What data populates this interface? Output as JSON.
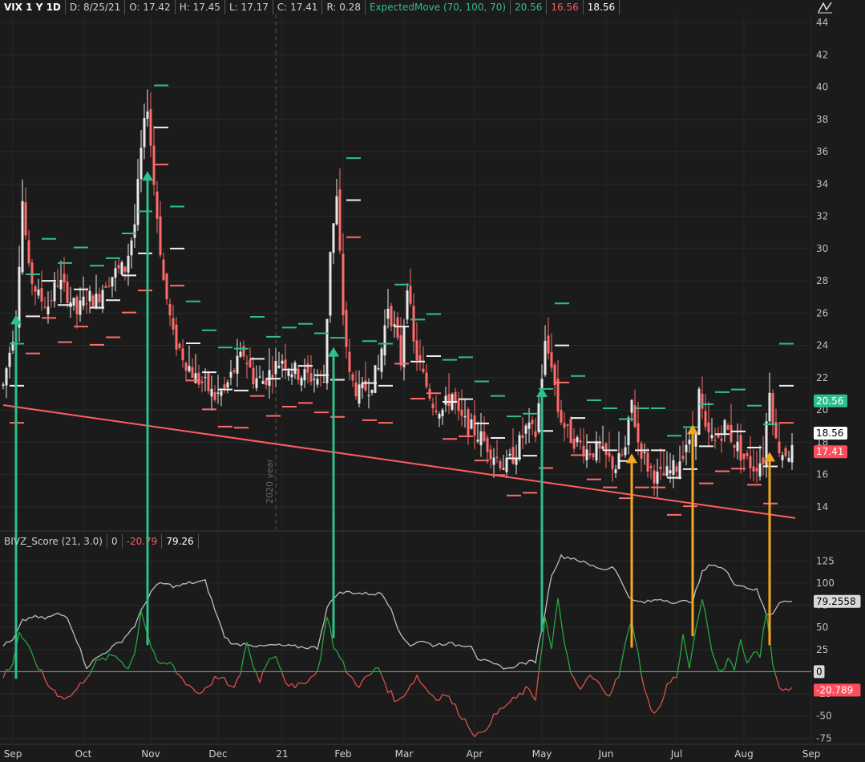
{
  "header": {
    "symbol": "VIX 1 Y 1D",
    "date": "D: 8/25/21",
    "open": "O: 17.42",
    "high": "H: 17.45",
    "low": "L: 17.17",
    "close": "C: 17.41",
    "range": "R: 0.28",
    "study": "ExpectedMove (70, 100, 70)",
    "upper": "20.56",
    "lower": "16.56",
    "mid": "18.56"
  },
  "subpanel": {
    "study": "BIVZ_Score (21, 3.0)",
    "zero": "0",
    "value1": "-20.79",
    "value2": "79.26"
  },
  "tool_icon": "drawing-tool-icon",
  "colors": {
    "background": "#1b1b1b",
    "up": "#e8e8e8",
    "down": "#ff6b6b",
    "teal": "#2fbf8a",
    "orange": "#f5a623",
    "trend": "#ff5f5f",
    "gray_line": "#bdbdbd",
    "green_line": "#26a641",
    "red_line": "#e0504a"
  },
  "chart_data": [
    {
      "type": "candlestick",
      "title": "VIX 1 Y 1D",
      "ylim": [
        12.6,
        44.5
      ],
      "yticks": [
        14,
        16,
        18,
        20,
        22,
        24,
        26,
        28,
        30,
        32,
        34,
        36,
        38,
        40,
        42,
        44
      ],
      "xticks": [
        {
          "label": "Sep",
          "x": 3
        },
        {
          "label": "Oct",
          "x": 25
        },
        {
          "label": "Nov",
          "x": 46
        },
        {
          "label": "Dec",
          "x": 67
        },
        {
          "label": "21",
          "x": 87
        },
        {
          "label": "Feb",
          "x": 106
        },
        {
          "label": "Mar",
          "x": 125
        },
        {
          "label": "Apr",
          "x": 147
        },
        {
          "label": "May",
          "x": 168
        },
        {
          "label": "Jun",
          "x": 188
        },
        {
          "label": "Jul",
          "x": 210
        },
        {
          "label": "Aug",
          "x": 231
        },
        {
          "label": "Sep",
          "x": 252
        }
      ],
      "year_marker": {
        "label": "2020 year",
        "x": 85
      },
      "price_labels": [
        {
          "value": 20.56,
          "text": "20.56",
          "style": "teal"
        },
        {
          "value": 18.56,
          "text": "18.56",
          "style": "white"
        },
        {
          "value": 17.41,
          "text": "17.41",
          "style": "red"
        }
      ],
      "trend_line": [
        [
          0,
          20.3
        ],
        [
          247,
          13.3
        ]
      ],
      "keypoints": [
        [
          0,
          21.5
        ],
        [
          4,
          25.8
        ],
        [
          6,
          33.0
        ],
        [
          8,
          28.5
        ],
        [
          11,
          27.0
        ],
        [
          14,
          26.5
        ],
        [
          17,
          28.0
        ],
        [
          20,
          27.2
        ],
        [
          23,
          26.0
        ],
        [
          26,
          27.0
        ],
        [
          29,
          26.8
        ],
        [
          32,
          28.0
        ],
        [
          35,
          28.5
        ],
        [
          38,
          28.8
        ],
        [
          41,
          31.5
        ],
        [
          43,
          36.0
        ],
        [
          45,
          39.0
        ],
        [
          47,
          34.0
        ],
        [
          50,
          28.0
        ],
        [
          53,
          24.5
        ],
        [
          57,
          23.0
        ],
        [
          60,
          22.0
        ],
        [
          63,
          21.5
        ],
        [
          66,
          20.8
        ],
        [
          69,
          21.2
        ],
        [
          72,
          22.5
        ],
        [
          75,
          23.5
        ],
        [
          78,
          22.0
        ],
        [
          81,
          21.8
        ],
        [
          84,
          22.5
        ],
        [
          87,
          23.2
        ],
        [
          90,
          22.5
        ],
        [
          93,
          22.2
        ],
        [
          97,
          22.0
        ],
        [
          100,
          21.8
        ],
        [
          102,
          30.0
        ],
        [
          104,
          33.0
        ],
        [
          106,
          26.0
        ],
        [
          108,
          22.0
        ],
        [
          111,
          21.0
        ],
        [
          114,
          21.5
        ],
        [
          117,
          22.5
        ],
        [
          120,
          26.5
        ],
        [
          122,
          25.0
        ],
        [
          124,
          23.0
        ],
        [
          126,
          28.0
        ],
        [
          128,
          24.0
        ],
        [
          131,
          22.0
        ],
        [
          134,
          20.5
        ],
        [
          137,
          20.0
        ],
        [
          140,
          21.0
        ],
        [
          142,
          19.5
        ],
        [
          145,
          19.0
        ],
        [
          148,
          18.5
        ],
        [
          151,
          17.8
        ],
        [
          154,
          17.0
        ],
        [
          157,
          16.5
        ],
        [
          160,
          17.5
        ],
        [
          163,
          18.8
        ],
        [
          166,
          18.5
        ],
        [
          169,
          24.0
        ],
        [
          171,
          23.0
        ],
        [
          173,
          20.0
        ],
        [
          176,
          18.5
        ],
        [
          179,
          18.0
        ],
        [
          182,
          17.5
        ],
        [
          185,
          17.5
        ],
        [
          188,
          17.0
        ],
        [
          191,
          16.5
        ],
        [
          194,
          17.5
        ],
        [
          196,
          20.5
        ],
        [
          198,
          18.0
        ],
        [
          201,
          16.5
        ],
        [
          204,
          15.8
        ],
        [
          207,
          16.0
        ],
        [
          210,
          16.5
        ],
        [
          213,
          18.0
        ],
        [
          215,
          17.5
        ],
        [
          217,
          21.0
        ],
        [
          219,
          18.5
        ],
        [
          222,
          18.0
        ],
        [
          225,
          19.0
        ],
        [
          228,
          18.0
        ],
        [
          231,
          17.0
        ],
        [
          234,
          16.5
        ],
        [
          237,
          17.0
        ],
        [
          239,
          21.5
        ],
        [
          241,
          18.0
        ],
        [
          243,
          17.4
        ]
      ],
      "arrows_teal": [
        {
          "x": 4,
          "y_from": -8,
          "y_to": 25.8
        },
        {
          "x": 45,
          "y_from": 30,
          "y_to": 34.7
        },
        {
          "x": 103,
          "y_from": 38,
          "y_to": 23.8
        },
        {
          "x": 168,
          "y_from": 45,
          "y_to": 21.3
        }
      ],
      "arrows_orange": [
        {
          "x": 196,
          "y_from": 27,
          "y_to": 17.2
        },
        {
          "x": 215,
          "y_from": 40,
          "y_to": 19.0
        },
        {
          "x": 239,
          "y_from": 30,
          "y_to": 17.3
        }
      ]
    },
    {
      "type": "line",
      "title": "BIVZ_Score (21, 3.0)",
      "ylim": [
        -82,
        137
      ],
      "yticks": [
        -75,
        -50,
        -25,
        0,
        25,
        50,
        75,
        100,
        125
      ],
      "value_labels": [
        {
          "value": 79.2558,
          "text": "79.2558",
          "style": "gray"
        },
        {
          "value": 0,
          "text": "0",
          "style": "gray"
        },
        {
          "value": -20.789,
          "text": "-20.789",
          "style": "red"
        }
      ],
      "series": [
        {
          "name": "",
          "keypoints": [
            [
              0,
              30
            ],
            [
              3,
              35
            ],
            [
              6,
              57
            ],
            [
              9,
              62
            ],
            [
              13,
              60
            ],
            [
              17,
              65
            ],
            [
              20,
              62
            ],
            [
              23,
              35
            ],
            [
              26,
              5
            ],
            [
              29,
              15
            ],
            [
              33,
              25
            ],
            [
              37,
              35
            ],
            [
              41,
              52
            ],
            [
              43,
              68
            ],
            [
              46,
              90
            ],
            [
              49,
              100
            ],
            [
              54,
              96
            ],
            [
              58,
              100
            ],
            [
              63,
              102
            ],
            [
              66,
              70
            ],
            [
              69,
              40
            ],
            [
              72,
              30
            ],
            [
              76,
              32
            ],
            [
              80,
              28
            ],
            [
              84,
              30
            ],
            [
              88,
              29
            ],
            [
              92,
              28
            ],
            [
              98,
              27
            ],
            [
              101,
              72
            ],
            [
              104,
              88
            ],
            [
              108,
              90
            ],
            [
              112,
              88
            ],
            [
              118,
              88
            ],
            [
              121,
              72
            ],
            [
              124,
              40
            ],
            [
              127,
              30
            ],
            [
              130,
              35
            ],
            [
              134,
              30
            ],
            [
              138,
              32
            ],
            [
              142,
              30
            ],
            [
              146,
              30
            ],
            [
              148,
              15
            ],
            [
              153,
              8
            ],
            [
              158,
              3
            ],
            [
              160,
              8
            ],
            [
              163,
              10
            ],
            [
              166,
              12
            ],
            [
              169,
              68
            ],
            [
              171,
              110
            ],
            [
              174,
              130
            ],
            [
              178,
              128
            ],
            [
              183,
              120
            ],
            [
              188,
              115
            ],
            [
              190,
              120
            ],
            [
              193,
              100
            ],
            [
              196,
              80
            ],
            [
              200,
              78
            ],
            [
              205,
              82
            ],
            [
              210,
              78
            ],
            [
              215,
              80
            ],
            [
              218,
              112
            ],
            [
              221,
              122
            ],
            [
              225,
              115
            ],
            [
              228,
              100
            ],
            [
              232,
              95
            ],
            [
              235,
              92
            ],
            [
              238,
              65
            ],
            [
              240,
              66
            ],
            [
              242,
              79
            ]
          ]
        },
        {
          "name": "",
          "keypoints": [
            [
              0,
              -5
            ],
            [
              3,
              10
            ],
            [
              5,
              45
            ],
            [
              8,
              25
            ],
            [
              11,
              5
            ],
            [
              14,
              -15
            ],
            [
              17,
              -25
            ],
            [
              20,
              -30
            ],
            [
              23,
              -20
            ],
            [
              26,
              -5
            ],
            [
              29,
              10
            ],
            [
              32,
              15
            ],
            [
              35,
              18
            ],
            [
              39,
              5
            ],
            [
              41,
              20
            ],
            [
              43,
              70
            ],
            [
              46,
              30
            ],
            [
              49,
              5
            ],
            [
              52,
              10
            ],
            [
              55,
              -5
            ],
            [
              58,
              -15
            ],
            [
              61,
              -25
            ],
            [
              64,
              -15
            ],
            [
              67,
              -5
            ],
            [
              69,
              -10
            ],
            [
              71,
              -20
            ],
            [
              74,
              -5
            ],
            [
              76,
              35
            ],
            [
              78,
              5
            ],
            [
              80,
              -10
            ],
            [
              82,
              10
            ],
            [
              85,
              20
            ],
            [
              88,
              -10
            ],
            [
              91,
              -20
            ],
            [
              94,
              -10
            ],
            [
              97,
              -5
            ],
            [
              99,
              15
            ],
            [
              101,
              65
            ],
            [
              103,
              30
            ],
            [
              105,
              15
            ],
            [
              108,
              -5
            ],
            [
              111,
              -15
            ],
            [
              114,
              -5
            ],
            [
              117,
              5
            ],
            [
              120,
              -20
            ],
            [
              123,
              -35
            ],
            [
              126,
              -20
            ],
            [
              129,
              -5
            ],
            [
              132,
              -20
            ],
            [
              135,
              -30
            ],
            [
              138,
              -25
            ],
            [
              141,
              -40
            ],
            [
              144,
              -55
            ],
            [
              147,
              -70
            ],
            [
              149,
              -72
            ],
            [
              152,
              -55
            ],
            [
              156,
              -40
            ],
            [
              160,
              -30
            ],
            [
              163,
              -20
            ],
            [
              166,
              -30
            ],
            [
              169,
              60
            ],
            [
              171,
              25
            ],
            [
              173,
              80
            ],
            [
              175,
              35
            ],
            [
              177,
              -5
            ],
            [
              180,
              -20
            ],
            [
              183,
              -5
            ],
            [
              186,
              -15
            ],
            [
              189,
              -25
            ],
            [
              192,
              -5
            ],
            [
              194,
              30
            ],
            [
              196,
              60
            ],
            [
              198,
              20
            ],
            [
              200,
              -20
            ],
            [
              202,
              -45
            ],
            [
              205,
              -40
            ],
            [
              207,
              -15
            ],
            [
              210,
              -5
            ],
            [
              212,
              40
            ],
            [
              214,
              5
            ],
            [
              216,
              45
            ],
            [
              218,
              85
            ],
            [
              220,
              40
            ],
            [
              222,
              10
            ],
            [
              224,
              0
            ],
            [
              226,
              15
            ],
            [
              228,
              5
            ],
            [
              230,
              35
            ],
            [
              232,
              10
            ],
            [
              234,
              25
            ],
            [
              236,
              15
            ],
            [
              238,
              70
            ],
            [
              240,
              10
            ],
            [
              242,
              -20
            ]
          ]
        }
      ]
    }
  ]
}
